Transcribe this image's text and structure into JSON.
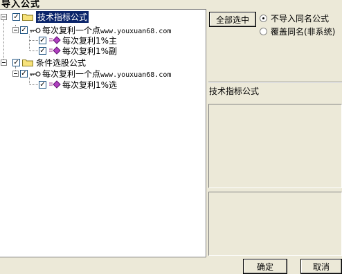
{
  "window": {
    "title": "导入公式"
  },
  "tree": {
    "root1": {
      "label": "技术指标公式",
      "child": {
        "label": "每次复利一个点www.youxuan68.com",
        "leaves": [
          "每次复利1%主",
          "每次复利1%副"
        ]
      }
    },
    "root2": {
      "label": "条件选股公式",
      "child": {
        "label": "每次复利一个点www.youxuan68.com",
        "leaves": [
          "每次复利1%选"
        ]
      }
    }
  },
  "options": {
    "select_all_label": "全部选中",
    "radio1_label": "不导入同名公式",
    "radio2_label": "覆盖同名(非系统)",
    "selected": "radio1"
  },
  "info": {
    "type_label": "技术指标公式"
  },
  "footer": {
    "ok_label": "确定",
    "cancel_label": "取消"
  }
}
